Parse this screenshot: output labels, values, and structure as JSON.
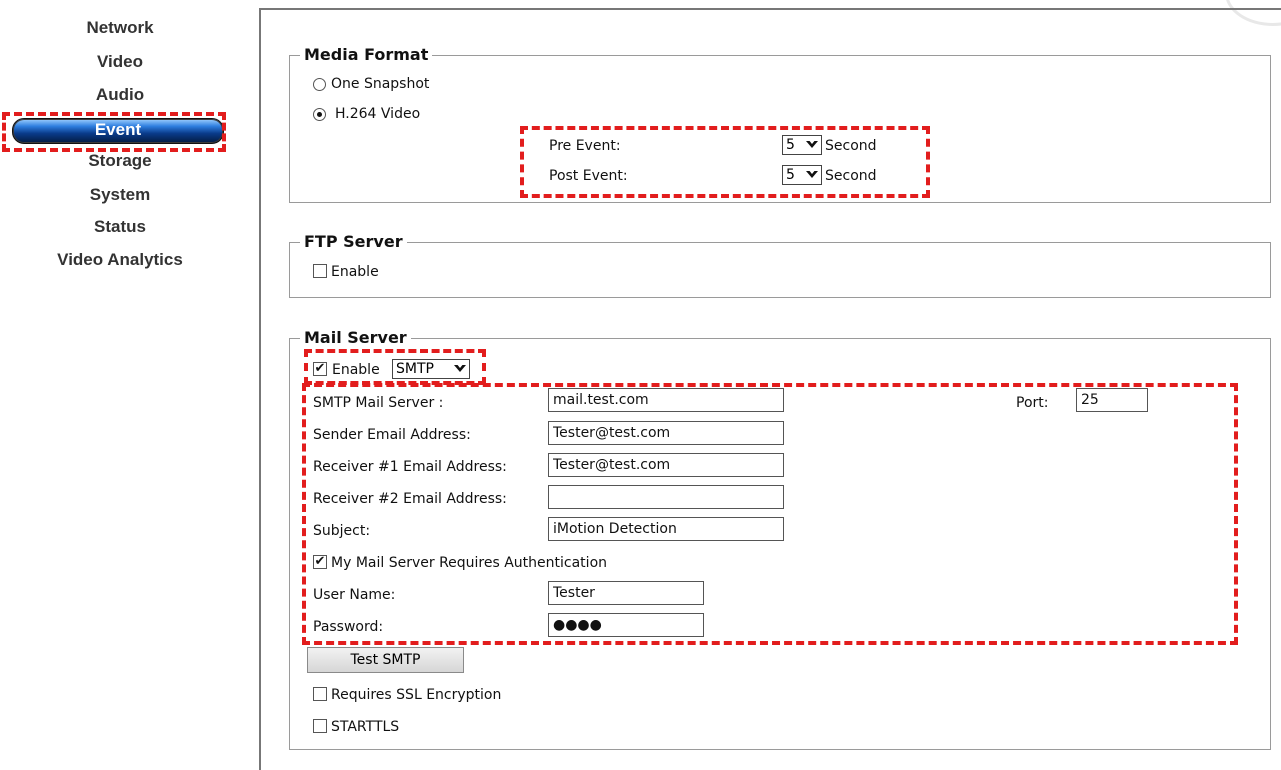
{
  "sidebar": {
    "items": [
      "Network",
      "Video",
      "Audio",
      "Event",
      "Storage",
      "System",
      "Status",
      "Video Analytics"
    ],
    "active": "Event"
  },
  "media_format": {
    "legend": "Media Format",
    "option_snapshot": "One Snapshot",
    "option_video": "H.264 Video",
    "selected": "H.264 Video",
    "pre_event_label": "Pre Event:",
    "pre_event_value": "5",
    "post_event_label": "Post Event:",
    "post_event_value": "5",
    "unit": "Second"
  },
  "ftp": {
    "legend": "FTP Server",
    "enable_label": "Enable",
    "enabled": false
  },
  "mail": {
    "legend": "Mail Server",
    "enable_label": "Enable",
    "enabled": true,
    "protocol": "SMTP",
    "smtp_server_label": "SMTP Mail Server :",
    "smtp_server_value": "mail.test.com",
    "port_label": "Port:",
    "port_value": "25",
    "sender_label": "Sender Email Address:",
    "sender_value": "Tester@test.com",
    "receiver1_label": "Receiver #1 Email Address:",
    "receiver1_value": "Tester@test.com",
    "receiver2_label": "Receiver #2 Email Address:",
    "receiver2_value": "",
    "subject_label": "Subject:",
    "subject_value": "iMotion Detection",
    "auth_label": "My Mail Server Requires Authentication",
    "auth_checked": true,
    "username_label": "User Name:",
    "username_value": "Tester",
    "password_label": "Password:",
    "password_value": "●●●●",
    "test_button": "Test SMTP",
    "ssl_label": "Requires SSL Encryption",
    "ssl_checked": false,
    "starttls_label": "STARTTLS",
    "starttls_checked": false
  },
  "colors": {
    "highlight": "#e21d1d",
    "active_nav": "#0a3b8a"
  }
}
